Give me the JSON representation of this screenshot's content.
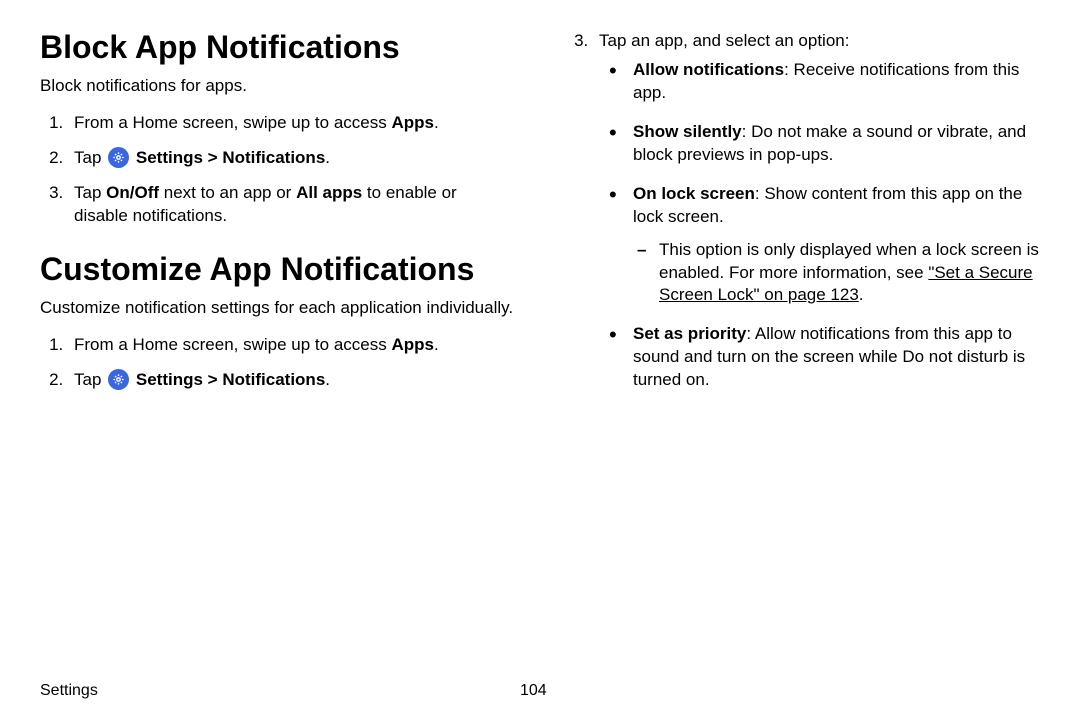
{
  "left": {
    "h1a": "Block App Notifications",
    "intro_a": "Block notifications for apps.",
    "a1_pre": "From a Home screen, swipe up to access ",
    "a1_b": "Apps",
    "tap": "Tap",
    "settings_path": "Settings > Notifications",
    "a3_pre": "Tap ",
    "a3_b1": "On/Off",
    "a3_mid": " next to an app or ",
    "a3_b2": "All apps",
    "a3_post": " to enable or disable notifications.",
    "h1b": "Customize App Notifications",
    "intro_b": "Customize notification settings for each application individually."
  },
  "right": {
    "r3": "Tap an app, and select an option:",
    "opt1_b": "Allow notifications",
    "opt1_t": ": Receive notifications from this app.",
    "opt2_b": "Show silently",
    "opt2_t": ": Do not make a sound or vibrate, and block previews in pop-ups.",
    "opt3_b": "On lock screen",
    "opt3_t": ": Show content from this app on the lock screen.",
    "opt3_sub_pre": "This option is only displayed when a lock screen is enabled. For more information, see ",
    "opt3_sub_link": "\"Set a Secure Screen Lock\" on page 123",
    "opt4_b": "Set as priority",
    "opt4_t": ": Allow notifications from this app to sound and turn on the screen while Do not disturb is turned on."
  },
  "footer": {
    "section": "Settings",
    "page": "104"
  },
  "period": "."
}
